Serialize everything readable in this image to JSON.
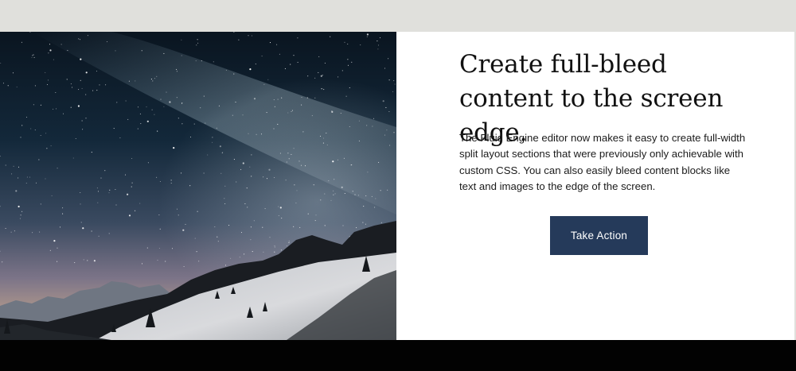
{
  "section": {
    "headline": "Create full-bleed content to the screen edge.",
    "body": "The Fluid Engine editor now makes it easy to create full-width split layout sections that were previously only achievable with custom CSS. You can also easily bleed content blocks like text and images to the edge of the screen.",
    "button_label": "Take Action"
  },
  "image": {
    "icon": "night-sky-mountain-photo"
  },
  "colors": {
    "top_band": "#e0e0dc",
    "button_bg": "#253a5a",
    "bottom_band": "#020202"
  }
}
